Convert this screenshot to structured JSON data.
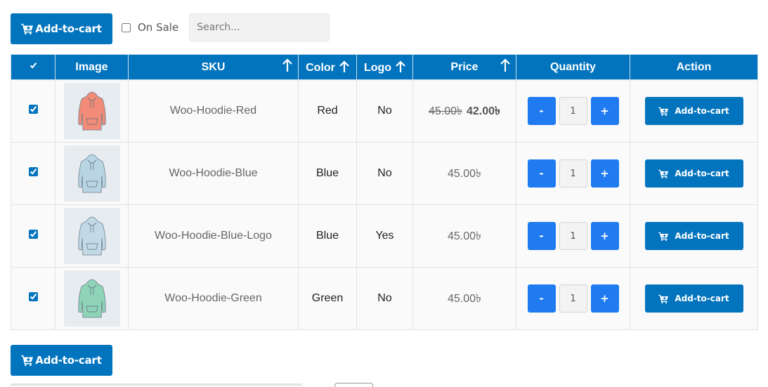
{
  "toolbar": {
    "add_to_cart_label": "Add-to-cart",
    "on_sale_label": "On Sale",
    "on_sale_checked": false,
    "search_placeholder": "Search..."
  },
  "table": {
    "headers": {
      "image": "Image",
      "sku": "SKU",
      "color": "Color",
      "logo": "Logo",
      "price": "Price",
      "quantity": "Quantity",
      "action": "Action"
    },
    "rows": [
      {
        "sku": "Woo-Hoodie-Red",
        "color": "Red",
        "logo": "No",
        "old_price": "45.00৳",
        "price": "42.00৳",
        "qty_minus": "-",
        "quantity": "1",
        "qty_plus": "+",
        "action": "Add-to-cart",
        "hoodie_color": "#f28b78",
        "checked": true
      },
      {
        "sku": "Woo-Hoodie-Blue",
        "color": "Blue",
        "logo": "No",
        "old_price": "",
        "price": "45.00৳",
        "qty_minus": "-",
        "quantity": "1",
        "qty_plus": "+",
        "action": "Add-to-cart",
        "hoodie_color": "#b9d4e3",
        "checked": true
      },
      {
        "sku": "Woo-Hoodie-Blue-Logo",
        "color": "Blue",
        "logo": "Yes",
        "old_price": "",
        "price": "45.00৳",
        "qty_minus": "-",
        "quantity": "1",
        "qty_plus": "+",
        "action": "Add-to-cart",
        "hoodie_color": "#c2d9e6",
        "checked": true
      },
      {
        "sku": "Woo-Hoodie-Green",
        "color": "Green",
        "logo": "No",
        "old_price": "",
        "price": "45.00৳",
        "qty_minus": "-",
        "quantity": "1",
        "qty_plus": "+",
        "action": "Add-to-cart",
        "hoodie_color": "#8fd3b8",
        "checked": true
      }
    ]
  },
  "footer": {
    "add_to_cart_label": "Add-to-cart"
  },
  "colors": {
    "accent": "#0274be",
    "qty_button": "#1f7bef"
  },
  "icons": {
    "cart": "cart-icon",
    "sort": "sort-arrow-up-icon"
  }
}
